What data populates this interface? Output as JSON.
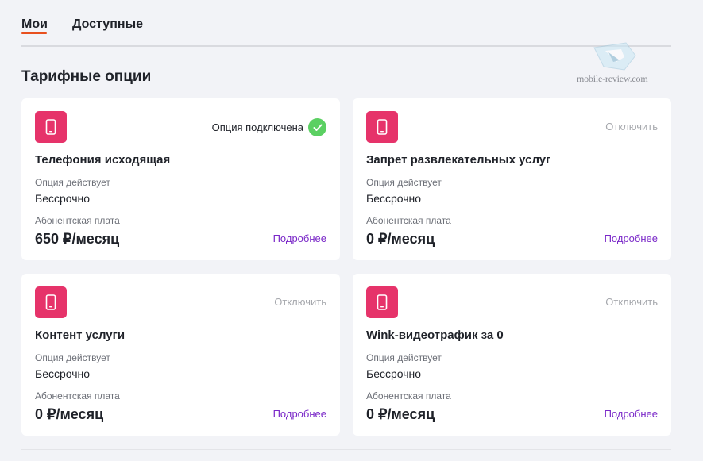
{
  "tabs": [
    {
      "label": "Мои"
    },
    {
      "label": "Доступные"
    }
  ],
  "watermark": "mobile-review.com",
  "section_title": "Тарифные опции",
  "colors": {
    "accent": "#e8501e",
    "icon_tile": "#e6336a",
    "link": "#7a28c8",
    "check": "#5bd062"
  },
  "cards": [
    {
      "icon": "phone-icon",
      "status": "Опция подключена",
      "name": "Телефония исходящая",
      "period_label": "Опция действует",
      "period_value": "Бессрочно",
      "fee_label": "Абонентская плата",
      "price": "650 ₽/месяц",
      "more": "Подробнее"
    },
    {
      "icon": "phone-icon",
      "status": "Отключить",
      "name": "Запрет развлекательных услуг",
      "period_label": "Опция действует",
      "period_value": "Бессрочно",
      "fee_label": "Абонентская плата",
      "price": "0 ₽/месяц",
      "more": "Подробнее"
    },
    {
      "icon": "phone-icon",
      "status": "Отключить",
      "name": "Контент услуги",
      "period_label": "Опция действует",
      "period_value": "Бессрочно",
      "fee_label": "Абонентская плата",
      "price": "0 ₽/месяц",
      "more": "Подробнее"
    },
    {
      "icon": "phone-icon",
      "status": "Отключить",
      "name": "Wink-видеотрафик за 0",
      "period_label": "Опция действует",
      "period_value": "Бессрочно",
      "fee_label": "Абонентская плата",
      "price": "0 ₽/месяц",
      "more": "Подробнее"
    }
  ]
}
